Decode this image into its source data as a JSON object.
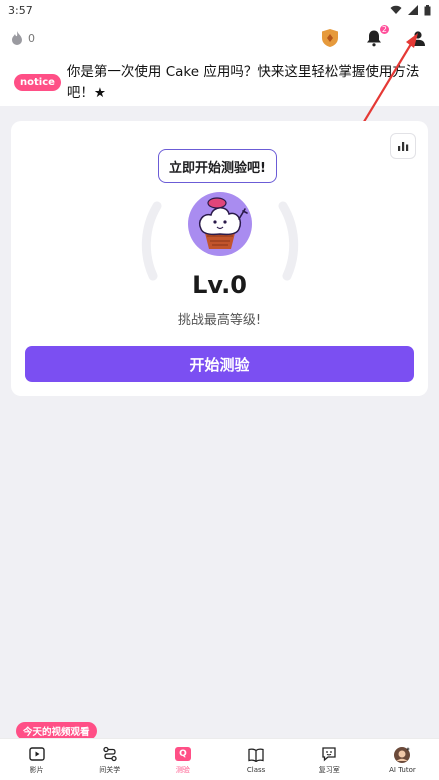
{
  "status_bar": {
    "time": "3:57"
  },
  "top_bar": {
    "streak_count": "0",
    "notification_count": "2"
  },
  "notice": {
    "tag": "notice",
    "text": "你是第一次使用 Cake 应用吗？快来这里轻松掌握使用方法吧！★"
  },
  "quiz_card": {
    "bubble_text": "立即开始测验吧!",
    "level": "Lv.0",
    "subtitle": "挑战最高等级!",
    "start_button": "开始测验"
  },
  "promo_label": "今天的视频观看",
  "tabs": [
    {
      "label": "影片",
      "icon": "play-icon"
    },
    {
      "label": "间关学",
      "icon": "route-icon"
    },
    {
      "label": "测验",
      "icon": "quiz-icon",
      "active": true
    },
    {
      "label": "Class",
      "icon": "book-icon"
    },
    {
      "label": "复习室",
      "icon": "review-icon"
    },
    {
      "label": "AI Tutor",
      "icon": "avatar-icon"
    }
  ],
  "colors": {
    "accent_purple": "#7b4ff2",
    "brand_pink": "#ff4f86",
    "arrow_red": "#e53935"
  }
}
